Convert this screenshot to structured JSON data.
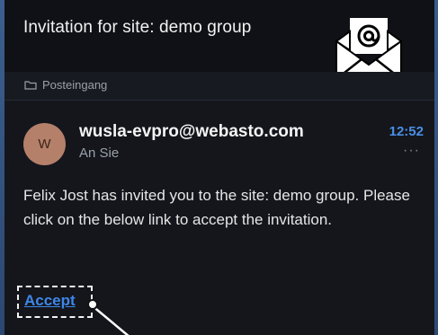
{
  "email": {
    "subject": "Invitation for site: demo group",
    "folder": "Posteingang",
    "avatar_initial": "W",
    "sender": "wusla-evpro@webasto.com",
    "recipient": "An Sie",
    "time": "12:52",
    "more": "···",
    "body": "Felix Jost has invited you to the site: demo group. Please click on the below link to accept the invitation.",
    "accept_link": "Accept"
  },
  "icons": {
    "envelope": "envelope-at-icon",
    "folder": "folder-icon",
    "more": "more-options-icon"
  },
  "colors": {
    "accent": "#3d87e8",
    "time": "#4a8fe6",
    "avatar": "#b5806a"
  }
}
